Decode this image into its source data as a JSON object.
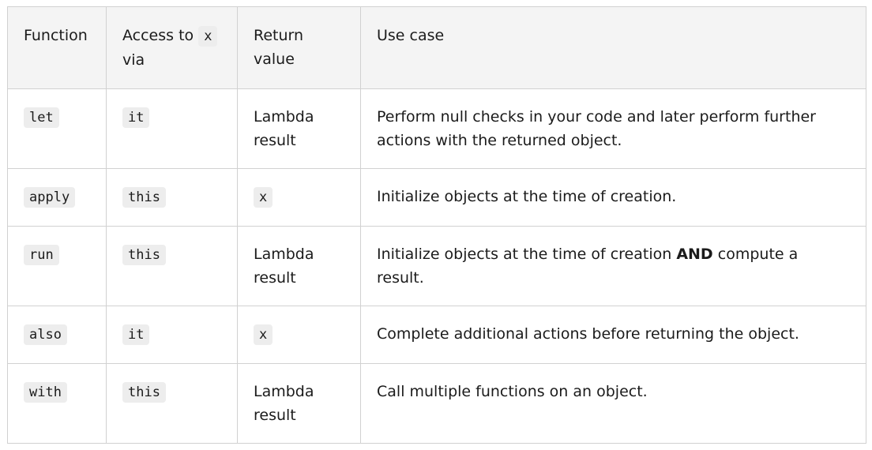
{
  "header": {
    "function": "Function",
    "access_prefix": "Access to",
    "access_code": "x",
    "access_suffix": "via",
    "return_value": "Return value",
    "use_case": "Use case"
  },
  "rows": [
    {
      "function": "let",
      "access": "it",
      "return_value": "Lambda result",
      "return_is_code": false,
      "use_case_before": "Perform null checks in your code and later perform further actions with the returned object.",
      "use_case_bold": "",
      "use_case_after": ""
    },
    {
      "function": "apply",
      "access": "this",
      "return_value": "x",
      "return_is_code": true,
      "use_case_before": "Initialize objects at the time of creation.",
      "use_case_bold": "",
      "use_case_after": ""
    },
    {
      "function": "run",
      "access": "this",
      "return_value": "Lambda result",
      "return_is_code": false,
      "use_case_before": "Initialize objects at the time of creation ",
      "use_case_bold": "AND",
      "use_case_after": " compute a result."
    },
    {
      "function": "also",
      "access": "it",
      "return_value": "x",
      "return_is_code": true,
      "use_case_before": "Complete additional actions before returning the object.",
      "use_case_bold": "",
      "use_case_after": ""
    },
    {
      "function": "with",
      "access": "this",
      "return_value": "Lambda result",
      "return_is_code": false,
      "use_case_before": "Call multiple functions on an object.",
      "use_case_bold": "",
      "use_case_after": ""
    }
  ]
}
